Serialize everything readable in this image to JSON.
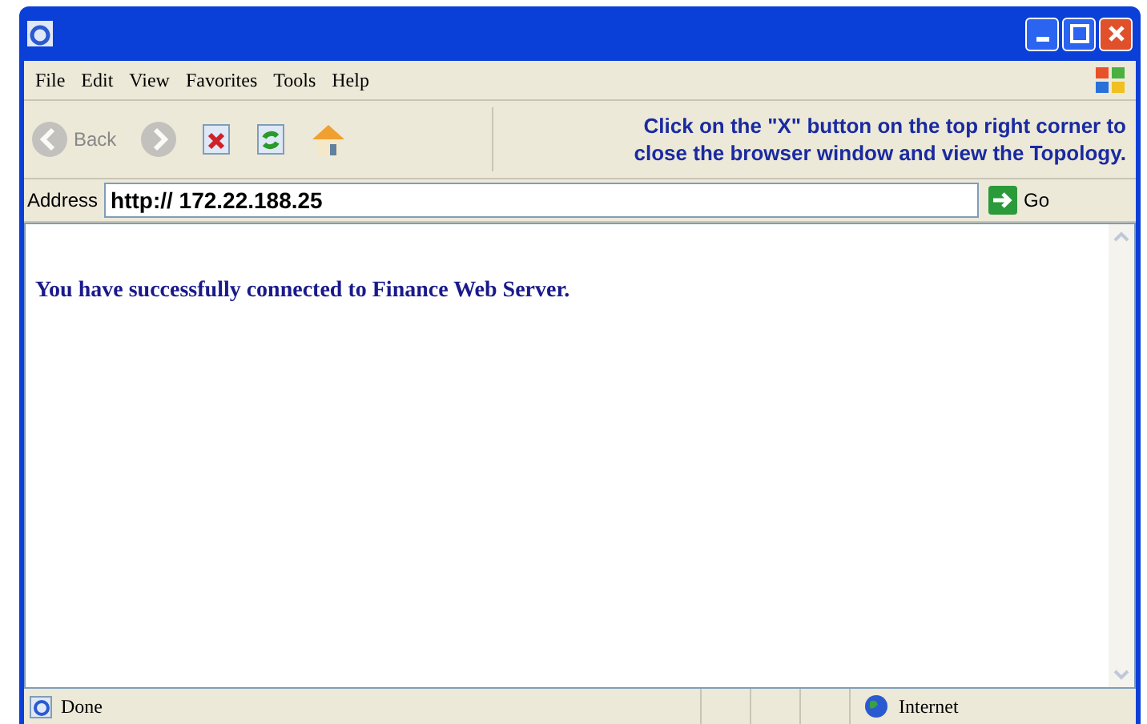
{
  "menu": [
    "File",
    "Edit",
    "View",
    "Favorites",
    "Tools",
    "Help"
  ],
  "toolbar": [
    {
      "kind": "back",
      "label": "Back",
      "disabled": true
    },
    {
      "kind": "forward",
      "disabled": true
    },
    {
      "kind": "stop",
      "disabled": false
    },
    {
      "kind": "refresh",
      "disabled": false
    },
    {
      "kind": "home",
      "disabled": false
    }
  ],
  "instruction": [
    "Click on the \"X\" button on the top right corner to",
    "close the browser window and view the Topology."
  ],
  "address": {
    "label": "Address",
    "value": "http:// 172.22.188.25",
    "go": "Go"
  },
  "content": {
    "message": "You have successfully connected to Finance Web Server."
  },
  "status_bar": {
    "status": "Done",
    "zone": "Internet"
  }
}
